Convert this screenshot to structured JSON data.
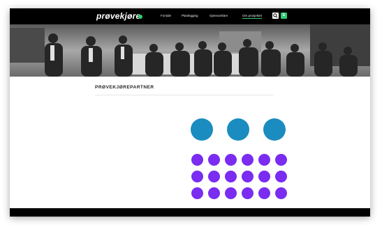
{
  "site": {
    "logo_text": "prøvekjøre",
    "accent_color": "#2ecc71"
  },
  "nav": {
    "items": [
      {
        "label": "Forside",
        "active": false
      },
      {
        "label": "Planlegging",
        "active": false
      },
      {
        "label": "Gjennomføre",
        "active": false
      },
      {
        "label": "Om prosjektet",
        "active": true
      }
    ],
    "search_icon": "search-icon",
    "lang_label": "E"
  },
  "hero": {
    "description_icon": "group-photo"
  },
  "page": {
    "title": "PRØVEKJØREPARTNER"
  },
  "partners": {
    "blue_color": "#1a8cc0",
    "purple_color": "#7a2cf0",
    "blue_count": 3,
    "purple_count": 18
  }
}
